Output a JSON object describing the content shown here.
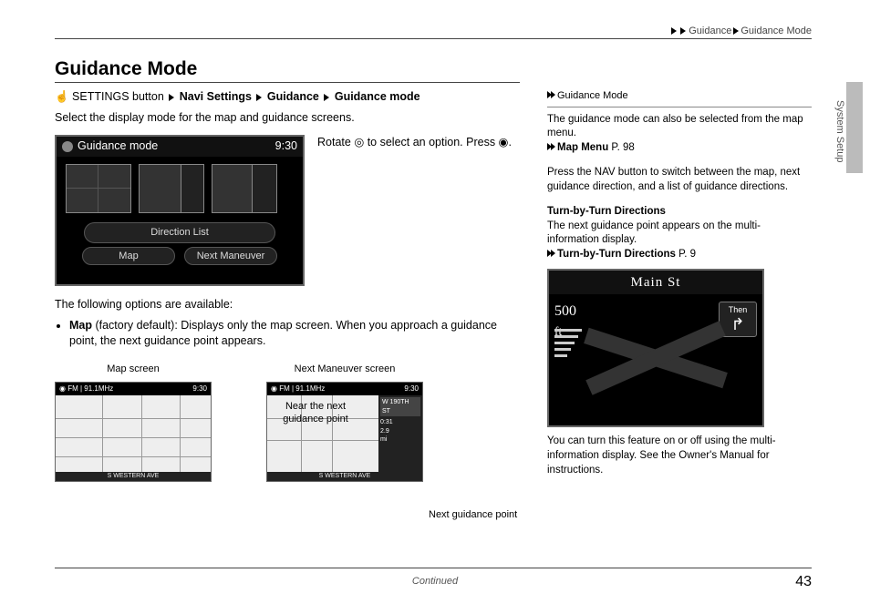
{
  "breadcrumb": {
    "a": "Guidance",
    "b": "Guidance Mode"
  },
  "title": "Guidance Mode",
  "path": {
    "pre": "SETTINGS button",
    "b1": "Navi Settings",
    "b2": "Guidance",
    "b3": "Guidance mode"
  },
  "intro": "Select the display mode for the map and guidance screens.",
  "rotate": {
    "a": "Rotate ",
    "b": " to select an option. Press ",
    "c": "."
  },
  "screen1": {
    "title": "Guidance mode",
    "time": "9:30",
    "opt1": "Direction List",
    "opt2a": "Map",
    "opt2b": "Next Maneuver"
  },
  "opts_intro": "The following options are available:",
  "bullet": {
    "b": "Map",
    "rest": " (factory default): Displays only the map screen. When you approach a guidance point, the next guidance point appears."
  },
  "shots": {
    "cap1": "Map screen",
    "cap2": "Next Maneuver screen",
    "between": "Near the next guidance point",
    "ngp": "Next guidance point",
    "mini": {
      "radio": "FM | 91.1MHz",
      "time": "9:30",
      "road": "S WESTERN AVE",
      "road2": "W 190TH ST"
    }
  },
  "aside": {
    "h": "Guidance Mode",
    "p1": "The guidance mode can also be selected from the map menu.",
    "link1b": "Map Menu",
    "link1p": " P. 98",
    "p2": "Press the NAV button to switch between the map, next guidance direction, and a list of guidance directions.",
    "sub": "Turn-by-Turn Directions",
    "p3": "The next guidance point appears on the multi-information display.",
    "link2b": "Turn-by-Turn Directions",
    "link2p": " P. 9",
    "ds": {
      "title": "Main St",
      "dist": "500",
      "unit": "ft",
      "then": "Then"
    },
    "p4": "You can turn this feature on or off using the multi-information display. See the Owner's Manual for instructions."
  },
  "sidetab": "System Setup",
  "continued": "Continued",
  "pnum": "43"
}
